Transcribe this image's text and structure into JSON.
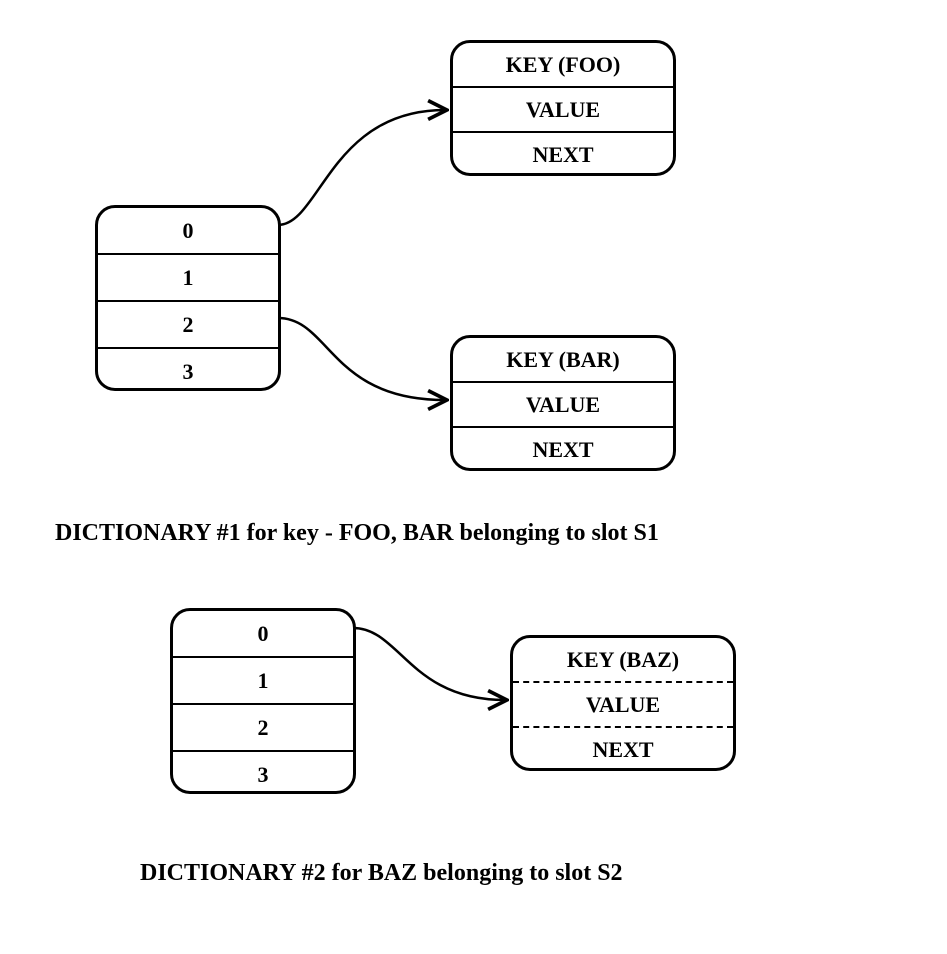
{
  "dict1": {
    "hash_table": [
      "0",
      "1",
      "2",
      "3"
    ],
    "node_foo": {
      "key": "KEY (FOO)",
      "value": "VALUE",
      "next": "NEXT"
    },
    "node_bar": {
      "key": "KEY (BAR)",
      "value": "VALUE",
      "next": "NEXT"
    },
    "caption": "DICTIONARY #1 for key - FOO, BAR belonging to slot S1"
  },
  "dict2": {
    "hash_table": [
      "0",
      "1",
      "2",
      "3"
    ],
    "node_baz": {
      "key": "KEY (BAZ)",
      "value": "VALUE",
      "next": "NEXT"
    },
    "caption": "DICTIONARY #2 for BAZ belonging to slot S2"
  },
  "chart_data": {
    "type": "table",
    "description": "Two separate hash-table dictionaries. Dictionary #1 indexes keys FOO and BAR (slot S1): hash slot 0 → linked-list node {key:FOO,value,next}; hash slot 2 → node {key:BAR,value,next}. Dictionary #2 indexes key BAZ (slot S2): hash slot 0 → node {key:BAZ,value,next}.",
    "dictionaries": [
      {
        "name": "DICTIONARY #1",
        "slot": "S1",
        "buckets": 4,
        "entries": [
          {
            "bucket": 0,
            "key": "FOO"
          },
          {
            "bucket": 2,
            "key": "BAR"
          }
        ]
      },
      {
        "name": "DICTIONARY #2",
        "slot": "S2",
        "buckets": 4,
        "entries": [
          {
            "bucket": 0,
            "key": "BAZ"
          }
        ]
      }
    ]
  }
}
